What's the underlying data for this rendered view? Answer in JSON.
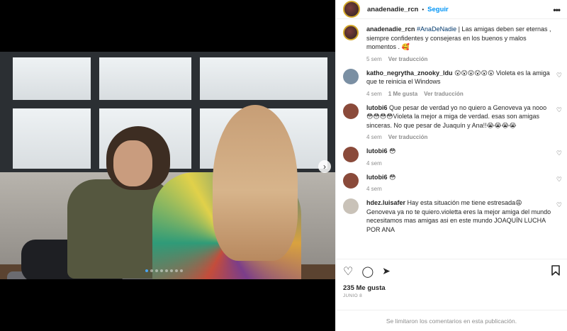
{
  "header": {
    "username": "anadenadie_rcn",
    "separator": "•",
    "follow_label": "Seguir",
    "more_icon": "more-horizontal-icon"
  },
  "caption": {
    "username": "anadenadie_rcn",
    "hashtag": "#AnaDeNadie",
    "text": " | Las amigas deben ser eternas , siempre confidentes y consejeras en los buenos y malos momentos . 🥰",
    "time": "5 sem",
    "translate": "Ver traducción"
  },
  "comments": [
    {
      "username": "katho_negrytha_znooky_ldu",
      "text": " 😮😮😮😮😮😮 Violeta es la amiga que te reinicia el Windows",
      "time": "4 sem",
      "likes": "1 Me gusta",
      "translate": "Ver traducción",
      "avatar_color": "#7a8fa3"
    },
    {
      "username": "lutobi6",
      "text": " Que pesar de verdad yo no quiero a Genoveva ya nooo 😳😳😳😳Violeta la mejor a miga de verdad. esas son amigas sinceras. No que pesar de Juaquín y Ana!!😭😭😭😭",
      "time": "4 sem",
      "likes": "",
      "translate": "Ver traducción",
      "avatar_color": "#8a4a3a"
    },
    {
      "username": "lutobi6",
      "text": " 😳",
      "time": "4 sem",
      "likes": "",
      "translate": "",
      "avatar_color": "#8a4a3a"
    },
    {
      "username": "lutobi6",
      "text": " 😳",
      "time": "4 sem",
      "likes": "",
      "translate": "",
      "avatar_color": "#8a4a3a"
    },
    {
      "username": "hdez.luisafer",
      "text": " Hay esta situación me tiene estresada😩 Genoveva ya no te quiero.violetta eres la mejor amiga del mundo necesitamos mas amigas asi en este mundo JOAQUÍN LUCHA POR ANA",
      "time": "",
      "likes": "",
      "translate": "",
      "avatar_color": "#c9c2b8"
    }
  ],
  "actions": {
    "like_icon": "heart-icon",
    "comment_icon": "comment-icon",
    "share_icon": "send-icon",
    "save_icon": "bookmark-icon"
  },
  "likes": "235 Me gusta",
  "date": "JUNIO 8",
  "footer_note": "Se limitaron los comentarios en esta publicación.",
  "carousel": {
    "slides": 8,
    "active_index": 0
  },
  "colors": {
    "follow": "#0095f6",
    "muted": "#8e8e8e",
    "text": "#262626"
  }
}
